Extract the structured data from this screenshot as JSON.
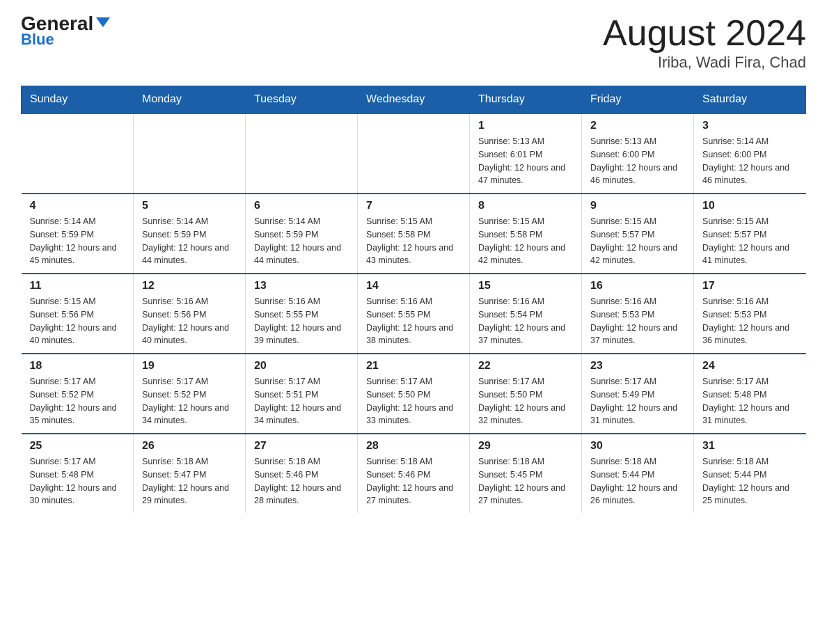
{
  "header": {
    "logo_general": "General",
    "logo_blue": "Blue",
    "title": "August 2024",
    "subtitle": "Iriba, Wadi Fira, Chad"
  },
  "days_of_week": [
    "Sunday",
    "Monday",
    "Tuesday",
    "Wednesday",
    "Thursday",
    "Friday",
    "Saturday"
  ],
  "weeks": [
    [
      {
        "day": "",
        "info": ""
      },
      {
        "day": "",
        "info": ""
      },
      {
        "day": "",
        "info": ""
      },
      {
        "day": "",
        "info": ""
      },
      {
        "day": "1",
        "info": "Sunrise: 5:13 AM\nSunset: 6:01 PM\nDaylight: 12 hours\nand 47 minutes."
      },
      {
        "day": "2",
        "info": "Sunrise: 5:13 AM\nSunset: 6:00 PM\nDaylight: 12 hours\nand 46 minutes."
      },
      {
        "day": "3",
        "info": "Sunrise: 5:14 AM\nSunset: 6:00 PM\nDaylight: 12 hours\nand 46 minutes."
      }
    ],
    [
      {
        "day": "4",
        "info": "Sunrise: 5:14 AM\nSunset: 5:59 PM\nDaylight: 12 hours\nand 45 minutes."
      },
      {
        "day": "5",
        "info": "Sunrise: 5:14 AM\nSunset: 5:59 PM\nDaylight: 12 hours\nand 44 minutes."
      },
      {
        "day": "6",
        "info": "Sunrise: 5:14 AM\nSunset: 5:59 PM\nDaylight: 12 hours\nand 44 minutes."
      },
      {
        "day": "7",
        "info": "Sunrise: 5:15 AM\nSunset: 5:58 PM\nDaylight: 12 hours\nand 43 minutes."
      },
      {
        "day": "8",
        "info": "Sunrise: 5:15 AM\nSunset: 5:58 PM\nDaylight: 12 hours\nand 42 minutes."
      },
      {
        "day": "9",
        "info": "Sunrise: 5:15 AM\nSunset: 5:57 PM\nDaylight: 12 hours\nand 42 minutes."
      },
      {
        "day": "10",
        "info": "Sunrise: 5:15 AM\nSunset: 5:57 PM\nDaylight: 12 hours\nand 41 minutes."
      }
    ],
    [
      {
        "day": "11",
        "info": "Sunrise: 5:15 AM\nSunset: 5:56 PM\nDaylight: 12 hours\nand 40 minutes."
      },
      {
        "day": "12",
        "info": "Sunrise: 5:16 AM\nSunset: 5:56 PM\nDaylight: 12 hours\nand 40 minutes."
      },
      {
        "day": "13",
        "info": "Sunrise: 5:16 AM\nSunset: 5:55 PM\nDaylight: 12 hours\nand 39 minutes."
      },
      {
        "day": "14",
        "info": "Sunrise: 5:16 AM\nSunset: 5:55 PM\nDaylight: 12 hours\nand 38 minutes."
      },
      {
        "day": "15",
        "info": "Sunrise: 5:16 AM\nSunset: 5:54 PM\nDaylight: 12 hours\nand 37 minutes."
      },
      {
        "day": "16",
        "info": "Sunrise: 5:16 AM\nSunset: 5:53 PM\nDaylight: 12 hours\nand 37 minutes."
      },
      {
        "day": "17",
        "info": "Sunrise: 5:16 AM\nSunset: 5:53 PM\nDaylight: 12 hours\nand 36 minutes."
      }
    ],
    [
      {
        "day": "18",
        "info": "Sunrise: 5:17 AM\nSunset: 5:52 PM\nDaylight: 12 hours\nand 35 minutes."
      },
      {
        "day": "19",
        "info": "Sunrise: 5:17 AM\nSunset: 5:52 PM\nDaylight: 12 hours\nand 34 minutes."
      },
      {
        "day": "20",
        "info": "Sunrise: 5:17 AM\nSunset: 5:51 PM\nDaylight: 12 hours\nand 34 minutes."
      },
      {
        "day": "21",
        "info": "Sunrise: 5:17 AM\nSunset: 5:50 PM\nDaylight: 12 hours\nand 33 minutes."
      },
      {
        "day": "22",
        "info": "Sunrise: 5:17 AM\nSunset: 5:50 PM\nDaylight: 12 hours\nand 32 minutes."
      },
      {
        "day": "23",
        "info": "Sunrise: 5:17 AM\nSunset: 5:49 PM\nDaylight: 12 hours\nand 31 minutes."
      },
      {
        "day": "24",
        "info": "Sunrise: 5:17 AM\nSunset: 5:48 PM\nDaylight: 12 hours\nand 31 minutes."
      }
    ],
    [
      {
        "day": "25",
        "info": "Sunrise: 5:17 AM\nSunset: 5:48 PM\nDaylight: 12 hours\nand 30 minutes."
      },
      {
        "day": "26",
        "info": "Sunrise: 5:18 AM\nSunset: 5:47 PM\nDaylight: 12 hours\nand 29 minutes."
      },
      {
        "day": "27",
        "info": "Sunrise: 5:18 AM\nSunset: 5:46 PM\nDaylight: 12 hours\nand 28 minutes."
      },
      {
        "day": "28",
        "info": "Sunrise: 5:18 AM\nSunset: 5:46 PM\nDaylight: 12 hours\nand 27 minutes."
      },
      {
        "day": "29",
        "info": "Sunrise: 5:18 AM\nSunset: 5:45 PM\nDaylight: 12 hours\nand 27 minutes."
      },
      {
        "day": "30",
        "info": "Sunrise: 5:18 AM\nSunset: 5:44 PM\nDaylight: 12 hours\nand 26 minutes."
      },
      {
        "day": "31",
        "info": "Sunrise: 5:18 AM\nSunset: 5:44 PM\nDaylight: 12 hours\nand 25 minutes."
      }
    ]
  ]
}
